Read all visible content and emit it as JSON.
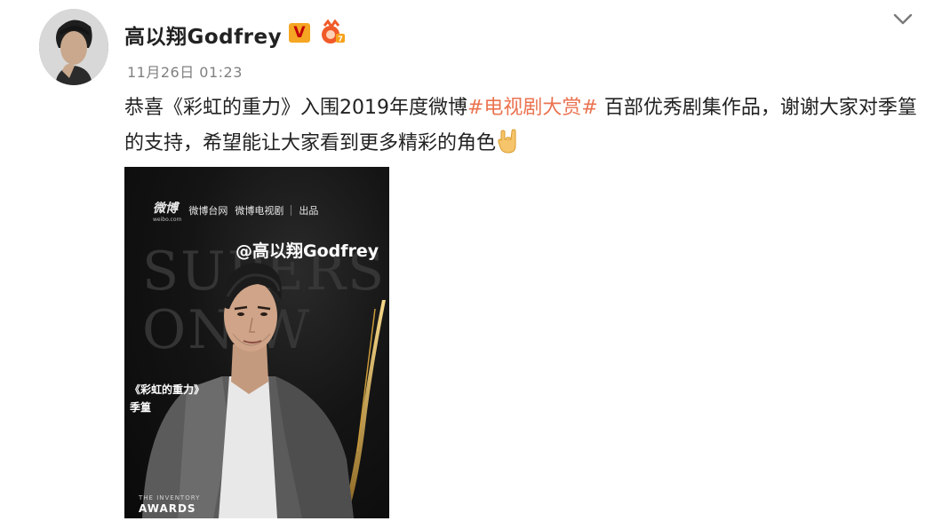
{
  "post": {
    "author": "高以翔Godfrey",
    "vip_badge": "V",
    "timestamp": "11月26日 01:23",
    "text_before": "恭喜《彩虹的重力》入围2019年度微博",
    "hashtag": "#电视剧大赏#",
    "text_after": " 百部优秀剧集作品，谢谢大家对季篁的支持，希望能让大家看到更多精彩的角色",
    "icons": [
      "avatar",
      "vip-v-icon",
      "medal-icon",
      "chevron-down-icon",
      "rock-hand-emoji"
    ]
  },
  "image": {
    "brand_weibo": "微博",
    "brand_weibo_sub": "weibo.com",
    "brand_2": "微博台网",
    "brand_3": "微博电视剧",
    "brand_4": "出品",
    "mention": "@高以翔Godfrey",
    "bg_text": "SUPERS ON W",
    "role_title": "《彩虹的重力》",
    "role_name": "季篁",
    "footer_small": "THE INVENTORY",
    "footer_big": "AWARDS"
  },
  "colors": {
    "hashtag": "#eb7350",
    "text": "#222222",
    "timestamp": "#808080",
    "vip_bg": "#f5a623"
  }
}
